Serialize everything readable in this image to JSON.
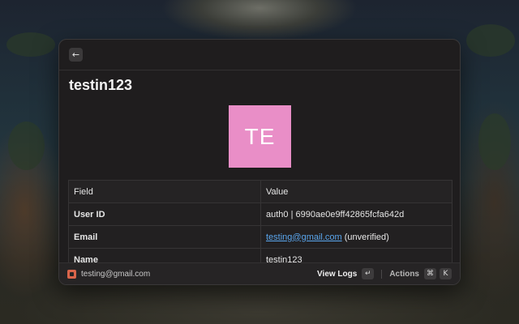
{
  "header": {
    "back_icon": "←"
  },
  "user": {
    "title": "testin123",
    "avatar_initials": "TE",
    "avatar_color": "#e98ec7"
  },
  "details_table": {
    "headers": [
      "Field",
      "Value"
    ],
    "rows": [
      {
        "field": "User ID",
        "value": "auth0 | 6990ae0e9ff42865fcfa642d"
      },
      {
        "field": "Email",
        "value": "testing@gmail.com",
        "suffix": " (unverified)"
      },
      {
        "field": "Name",
        "value": "testin123"
      }
    ]
  },
  "footer": {
    "account_email": "testing@gmail.com",
    "view_logs_label": "View Logs",
    "enter_key": "↵",
    "actions_label": "Actions",
    "cmd_key": "⌘",
    "k_key": "K"
  },
  "colors": {
    "accent_link": "#5aa6ee",
    "window_bg": "#1f1d1e",
    "logo": "#d9644a"
  }
}
